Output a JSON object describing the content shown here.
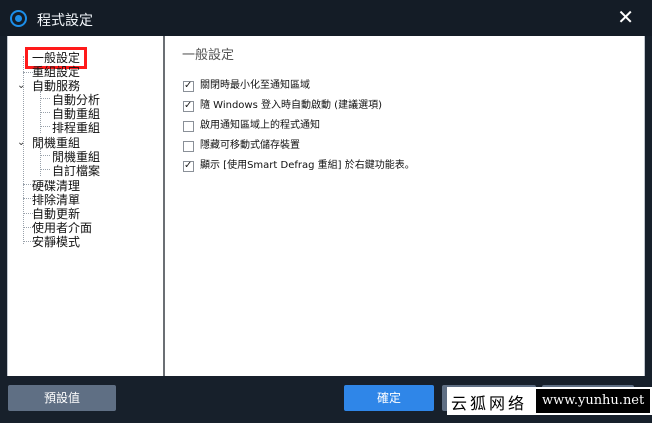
{
  "window": {
    "title": "程式設定"
  },
  "tree": {
    "items": [
      {
        "label": "一般設定",
        "selected": true
      },
      {
        "label": "重組設定"
      },
      {
        "label": "自動服務",
        "expanded": true
      },
      {
        "label": "自動分析"
      },
      {
        "label": "自動重組"
      },
      {
        "label": "排程重組"
      },
      {
        "label": "閒機重組",
        "expanded": true
      },
      {
        "label": "閒機重組"
      },
      {
        "label": "自訂檔案"
      },
      {
        "label": "硬碟清理"
      },
      {
        "label": "排除清單"
      },
      {
        "label": "自動更新"
      },
      {
        "label": "使用者介面"
      },
      {
        "label": "安靜模式"
      }
    ]
  },
  "panel": {
    "title": "一般設定",
    "options": [
      {
        "label": "關閉時最小化至通知區域",
        "checked": true
      },
      {
        "label": "隨 Windows 登入時自動啟動 (建議選項)",
        "checked": true
      },
      {
        "label": "啟用通知區域上的程式通知",
        "checked": false
      },
      {
        "label": "隱藏可移動式儲存裝置",
        "checked": false
      },
      {
        "label": "顯示 [使用Smart Defrag 重組] 於右鍵功能表。",
        "checked": true
      }
    ]
  },
  "footer": {
    "default_label": "預設值",
    "ok_label": "確定",
    "cancel_label": "",
    "apply_label": ""
  },
  "watermark": {
    "cn": "云狐网络",
    "url": "www.yunhu.net"
  },
  "colors": {
    "accent": "#2f86e8",
    "title_bg": "#141c26",
    "selection_border": "#ff1a1a"
  }
}
